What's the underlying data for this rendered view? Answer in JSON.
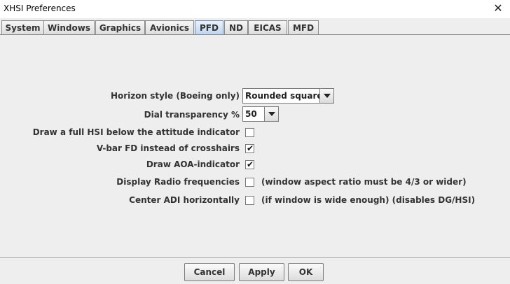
{
  "window": {
    "title": "XHSI Preferences"
  },
  "tabs": [
    {
      "label": "System"
    },
    {
      "label": "Windows"
    },
    {
      "label": "Graphics"
    },
    {
      "label": "Avionics"
    },
    {
      "label": "PFD",
      "active": true
    },
    {
      "label": "ND"
    },
    {
      "label": "EICAS"
    },
    {
      "label": "MFD"
    }
  ],
  "pfd": {
    "horizon_style": {
      "label": "Horizon style (Boeing only)",
      "value": "Rounded square"
    },
    "dial_transparency": {
      "label": "Dial transparency %",
      "value": "50"
    },
    "full_hsi": {
      "label": "Draw a full HSI below the attitude indicator",
      "checked": false
    },
    "vbar_fd": {
      "label": "V-bar FD instead of crosshairs",
      "checked": true
    },
    "aoa": {
      "label": "Draw AOA-indicator",
      "checked": true
    },
    "radio_freq": {
      "label": "Display Radio frequencies",
      "checked": false,
      "note": "(window aspect ratio must be 4/3 or wider)"
    },
    "center_adi": {
      "label": "Center ADI horizontally",
      "checked": false,
      "note": "(if window is wide enough) (disables DG/HSI)"
    }
  },
  "checkmark": "✔",
  "buttons": {
    "cancel": "Cancel",
    "apply": "Apply",
    "ok": "OK"
  },
  "icons": {
    "close": "close-icon",
    "dropdown": "chevron-down-icon"
  }
}
